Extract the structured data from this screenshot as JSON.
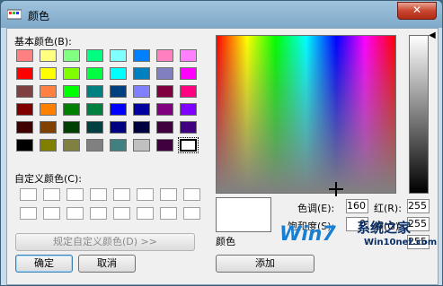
{
  "window": {
    "title": "颜色",
    "close_glyph": "✕"
  },
  "basic_colors": {
    "label": "基本颜色(B):",
    "swatches": [
      "#ff8080",
      "#ffff80",
      "#80ff80",
      "#00ff80",
      "#80ffff",
      "#0080ff",
      "#ff80c0",
      "#ff80ff",
      "#ff0000",
      "#ffff00",
      "#80ff00",
      "#00ff40",
      "#00ffff",
      "#0080c0",
      "#8080c0",
      "#ff00ff",
      "#804040",
      "#ff8040",
      "#00ff00",
      "#008080",
      "#004080",
      "#8080ff",
      "#800040",
      "#ff0080",
      "#800000",
      "#ff8000",
      "#008000",
      "#008040",
      "#0000ff",
      "#0000a0",
      "#800080",
      "#8000ff",
      "#400000",
      "#804000",
      "#004000",
      "#004040",
      "#000080",
      "#000040",
      "#400040",
      "#400080",
      "#000000",
      "#808000",
      "#808040",
      "#808080",
      "#408080",
      "#c0c0c0",
      "#400040",
      "#ffffff"
    ]
  },
  "custom_colors": {
    "label": "自定义颜色(C):",
    "count": 16
  },
  "buttons": {
    "define": "规定自定义颜色(D) >>",
    "ok": "确定",
    "cancel": "取消",
    "add": "添加"
  },
  "preview": {
    "label": "颜色"
  },
  "fields": {
    "hue_label": "色调(E):",
    "hue": "160",
    "sat_label": "饱和度(S):",
    "sat": "0",
    "red_label": "红(R):",
    "red": "255",
    "green_label": "绿(G):",
    "green": "255",
    "blue_value": "255"
  },
  "icons": {
    "title": "color-palette-icon",
    "close": "close-icon",
    "luminance_arrow": "triangle-left-icon"
  },
  "watermark": {
    "logo": "Win7",
    "brand": "系统之家",
    "url": "Win10net.com"
  }
}
